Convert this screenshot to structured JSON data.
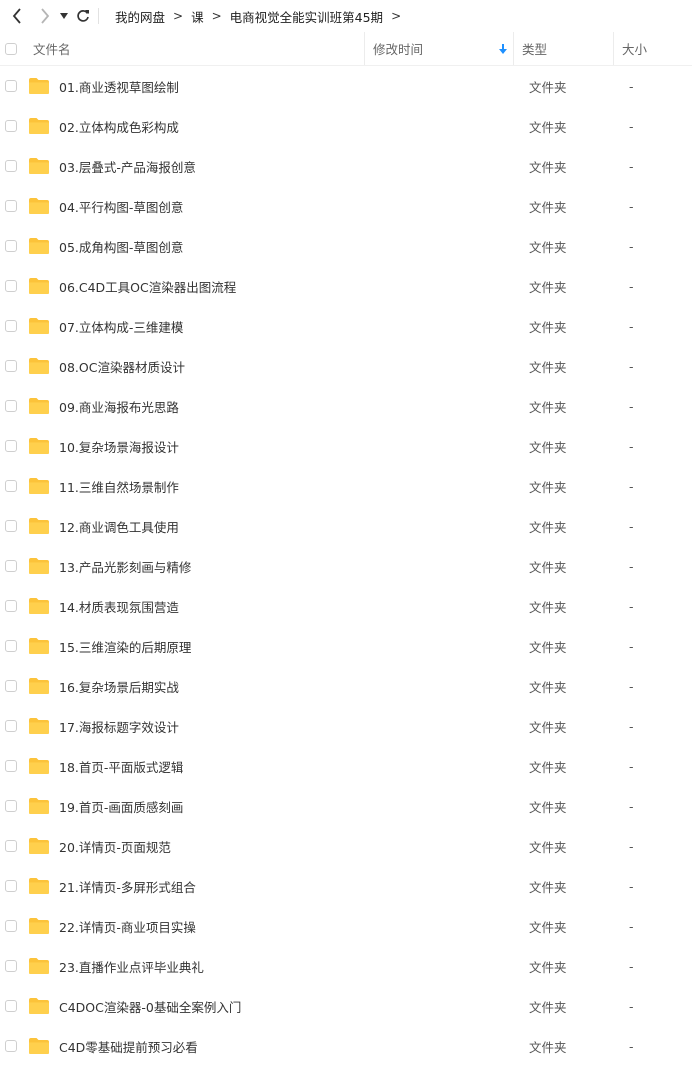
{
  "toolbar": {
    "back_icon": "chevron-left-icon",
    "forward_icon": "chevron-right-icon",
    "history_icon": "caret-down-icon",
    "refresh_icon": "refresh-icon"
  },
  "breadcrumb": [
    "我的网盘",
    "课",
    "电商视觉全能实训班第45期"
  ],
  "columns": {
    "name": "文件名",
    "mtime": "修改时间",
    "type": "类型",
    "size": "大小"
  },
  "colors": {
    "folder": "#fcc33a",
    "sort_arrow": "#1e90ff"
  },
  "files": [
    {
      "name": "01.商业透视草图绘制",
      "type": "文件夹",
      "size": "-"
    },
    {
      "name": "02.立体构成色彩构成",
      "type": "文件夹",
      "size": "-"
    },
    {
      "name": "03.层叠式-产品海报创意",
      "type": "文件夹",
      "size": "-"
    },
    {
      "name": "04.平行构图-草图创意",
      "type": "文件夹",
      "size": "-"
    },
    {
      "name": "05.成角构图-草图创意",
      "type": "文件夹",
      "size": "-"
    },
    {
      "name": "06.C4D工具OC渲染器出图流程",
      "type": "文件夹",
      "size": "-"
    },
    {
      "name": "07.立体构成-三维建模",
      "type": "文件夹",
      "size": "-"
    },
    {
      "name": "08.OC渲染器材质设计",
      "type": "文件夹",
      "size": "-"
    },
    {
      "name": "09.商业海报布光思路",
      "type": "文件夹",
      "size": "-"
    },
    {
      "name": "10.复杂场景海报设计",
      "type": "文件夹",
      "size": "-"
    },
    {
      "name": "11.三维自然场景制作",
      "type": "文件夹",
      "size": "-"
    },
    {
      "name": "12.商业调色工具使用",
      "type": "文件夹",
      "size": "-"
    },
    {
      "name": "13.产品光影刻画与精修",
      "type": "文件夹",
      "size": "-"
    },
    {
      "name": "14.材质表现氛围营造",
      "type": "文件夹",
      "size": "-"
    },
    {
      "name": "15.三维渲染的后期原理",
      "type": "文件夹",
      "size": "-"
    },
    {
      "name": "16.复杂场景后期实战",
      "type": "文件夹",
      "size": "-"
    },
    {
      "name": "17.海报标题字效设计",
      "type": "文件夹",
      "size": "-"
    },
    {
      "name": "18.首页-平面版式逻辑",
      "type": "文件夹",
      "size": "-"
    },
    {
      "name": "19.首页-画面质感刻画",
      "type": "文件夹",
      "size": "-"
    },
    {
      "name": "20.详情页-页面规范",
      "type": "文件夹",
      "size": "-"
    },
    {
      "name": "21.详情页-多屏形式组合",
      "type": "文件夹",
      "size": "-"
    },
    {
      "name": "22.详情页-商业项目实操",
      "type": "文件夹",
      "size": "-"
    },
    {
      "name": "23.直播作业点评毕业典礼",
      "type": "文件夹",
      "size": "-"
    },
    {
      "name": "C4DOC渲染器-0基础全案例入门",
      "type": "文件夹",
      "size": "-"
    },
    {
      "name": "C4D零基础提前预习必看",
      "type": "文件夹",
      "size": "-"
    }
  ]
}
